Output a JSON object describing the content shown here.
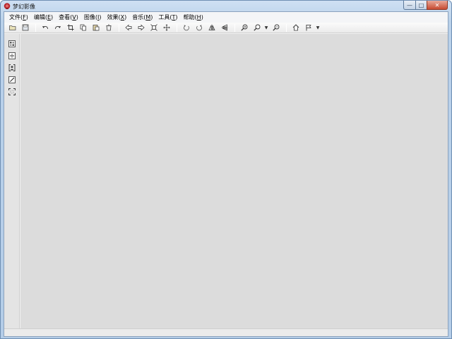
{
  "window": {
    "title": "梦幻影像",
    "controls": {
      "minimize": "—",
      "maximize": "□",
      "close": "✕"
    }
  },
  "menubar": {
    "items": [
      {
        "label": "文件",
        "key": "F"
      },
      {
        "label": "编辑",
        "key": "E"
      },
      {
        "label": "查看",
        "key": "V"
      },
      {
        "label": "图像",
        "key": "I"
      },
      {
        "label": "效果",
        "key": "X"
      },
      {
        "label": "音乐",
        "key": "M"
      },
      {
        "label": "工具",
        "key": "T"
      },
      {
        "label": "帮助",
        "key": "H"
      }
    ]
  },
  "toolbar": {
    "buttons": [
      "open-folder-icon",
      "save-icon",
      "undo-icon",
      "redo-icon",
      "crop-icon",
      "copy-icon",
      "paste-icon",
      "delete-icon",
      "arrow-left-icon",
      "arrow-right-icon",
      "fit-window-icon",
      "move-icon",
      "rotate-left-icon",
      "rotate-right-icon",
      "flip-horizontal-icon",
      "flip-vertical-icon",
      "zoom-in-icon",
      "zoom-dropdown-icon",
      "zoom-out-icon",
      "home-icon",
      "flag-icon"
    ]
  },
  "sidebar": {
    "tools": [
      "image-grid-icon",
      "fit-screen-icon",
      "portrait-frame-icon",
      "brush-icon",
      "fullscreen-icon"
    ]
  },
  "colors": {
    "titlebar": "#cfe0f3",
    "canvas": "#dcdcdc",
    "close_button": "#c74a31",
    "app_icon": "#b7262d"
  }
}
